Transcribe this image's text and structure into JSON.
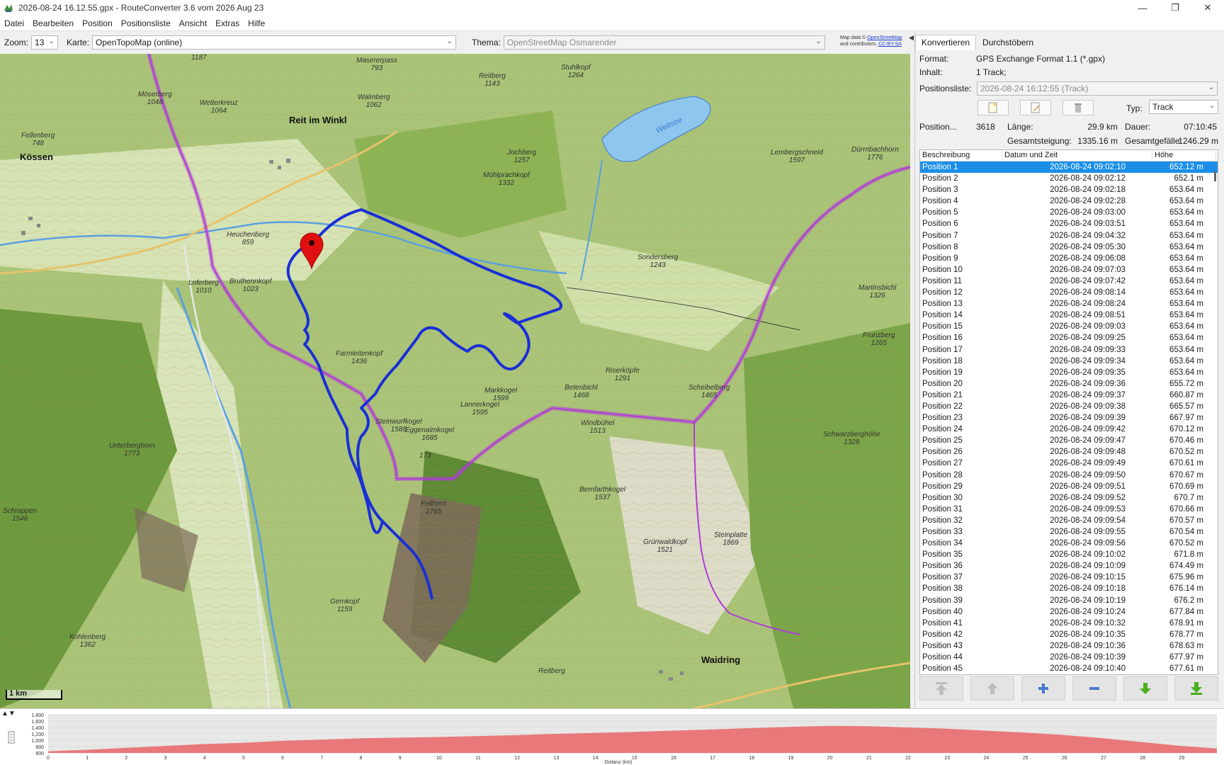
{
  "window": {
    "title": "2026-08-24 16.12.55.gpx - RouteConverter 3.6 vom 2026 Aug 23",
    "minimize": "—",
    "maximize": "❐",
    "close": "✕"
  },
  "menu": [
    "Datei",
    "Bearbeiten",
    "Position",
    "Positionsliste",
    "Ansicht",
    "Extras",
    "Hilfe"
  ],
  "map_toolbar": {
    "zoom_label": "Zoom:",
    "zoom_value": "13",
    "map_label": "Karte:",
    "map_value": "OpenTopoMap (online)",
    "theme_label": "Thema:",
    "theme_value": "OpenStreetMap Osmarender",
    "attribution_prefix": "Map data ©",
    "attribution_link1": "OpenStreetMap",
    "attribution_mid": "and contributors,",
    "attribution_link2": "CC-BY-SA"
  },
  "map": {
    "scale_label": "1 km",
    "labels": {
      "maserer": "Masererpass",
      "maserer_h": "793",
      "reitberg_top": "Reitberg",
      "reitberg_top_h": "1143",
      "stuhlkopf": "Stuhlkopf",
      "stuhlkopf_h": "1264",
      "weitsee": "Weitsee",
      "moserberg": "Möserberg",
      "moserberg_h": "1048",
      "wetterkreuz": "Wetterkreuz",
      "wetterkreuz_h": "1064",
      "walmberg": "Walmberg",
      "walmberg_h": "1062",
      "reit": "Reit im Winkl",
      "fellenberg": "Fellenberg",
      "fellenberg_h": "748",
      "kossen": "Kössen",
      "jochberg": "Jochberg",
      "jochberg_h": "1257",
      "muhlprachkopf": "Mühlprachkopf",
      "muhlprachkopf_h": "1332",
      "lembergschneid": "Lembergschneid",
      "lembergschneid_h": "1597",
      "durnbachhorn": "Dürrnbachhorn",
      "durnbachhorn_h": "1776",
      "heuchenberg": "Heuchenberg",
      "heuchenberg_h": "859",
      "sondersberg": "Sondersberg",
      "sondersberg_h": "1243",
      "loferberg": "Loferberg",
      "loferberg_h": "1010",
      "bruthenkopf": "Bruthennkopf",
      "bruthenkopf_h": "1023",
      "martinsbichl": "Martinsbichl",
      "martinsbichl_h": "1326",
      "frunzberg": "Frunzberg",
      "frunzberg_h": "1265",
      "farmleiten": "Farmleitenkopf",
      "farmleiten_h": "1436",
      "riserkopfe": "Riserköpfe",
      "riserkopfe_h": "1291",
      "markkogel": "Markkogel",
      "markkogel_h": "1599",
      "betenbichl": "Betenbichl",
      "betenbichl_h": "1468",
      "scheibelberg": "Scheibelberg",
      "scheibelberg_h": "1465",
      "lannerkogel": "Lannerkogel",
      "lannerkogel_h": "1595",
      "steinwurf": "Steinwurfkogel",
      "steinwurf_h": "1588",
      "eggenalm": "Eggenalmkogel",
      "eggenalm_h": "1685",
      "windbuhel": "Windbühel",
      "windbuhel_h": "1513",
      "schwarzberg": "Schwarzberghöhe",
      "schwarzberg_h": "1328",
      "unterberghorn": "Unterberghorn",
      "unterberghorn_h": "1773",
      "fellhorn": "Fellhorn",
      "fellhorn_h": "1765",
      "bernfarth": "Bernfarthkogel",
      "bernfarth_h": "1537",
      "schrappen": "Schrappen",
      "schrappen_h": "1546",
      "steinplatte": "Steinplatte",
      "steinplatte_h": "1869",
      "grunwald": "Grünwaldkopf",
      "grunwald_h": "1521",
      "gernkopf": "Gernkopf",
      "gernkopf_h": "1159",
      "kohlenberg": "Kohlenberg",
      "kohlenberg_h": "1362",
      "reitberg_bottom": "Reitberg",
      "waidring": "Waidring",
      "m1187": "1187",
      "m173": "173"
    }
  },
  "side": {
    "tabs": [
      "Konvertieren",
      "Durchstöbern"
    ],
    "format_label": "Format:",
    "format_value": "GPS Exchange Format 1.1 (*.gpx)",
    "content_label": "Inhalt:",
    "content_value": "1 Track;",
    "poslist_label": "Positionsliste:",
    "poslist_value": "2026-08-24 16:12:55 (Track)",
    "type_label": "Typ:",
    "type_value": "Track",
    "position_label": "Position...",
    "position_value": "3618",
    "length_label": "Länge:",
    "length_value": "29.9 km",
    "duration_label": "Dauer:",
    "duration_value": "07:10:45",
    "ascent_label": "Gesamtsteigung:",
    "ascent_value": "1335.16 m",
    "descent_label": "Gesamtgefälle:",
    "descent_value": "1246.29 m",
    "columns": [
      "Beschreibung",
      "Datum und Zeit",
      "Höhe"
    ],
    "rows": [
      [
        "Position 1",
        "2026-08-24 09:02:10",
        "652.12 m"
      ],
      [
        "Position 2",
        "2026-08-24 09:02:12",
        "652.1 m"
      ],
      [
        "Position 3",
        "2026-08-24 09:02:18",
        "653.64 m"
      ],
      [
        "Position 4",
        "2026-08-24 09:02:28",
        "653.64 m"
      ],
      [
        "Position 5",
        "2026-08-24 09:03:00",
        "653.64 m"
      ],
      [
        "Position 6",
        "2026-08-24 09:03:51",
        "653.64 m"
      ],
      [
        "Position 7",
        "2026-08-24 09:04:32",
        "653.64 m"
      ],
      [
        "Position 8",
        "2026-08-24 09:05:30",
        "653.64 m"
      ],
      [
        "Position 9",
        "2026-08-24 09:06:08",
        "653.64 m"
      ],
      [
        "Position 10",
        "2026-08-24 09:07:03",
        "653.64 m"
      ],
      [
        "Position 11",
        "2026-08-24 09:07:42",
        "653.64 m"
      ],
      [
        "Position 12",
        "2026-08-24 09:08:14",
        "653.64 m"
      ],
      [
        "Position 13",
        "2026-08-24 09:08:24",
        "653.64 m"
      ],
      [
        "Position 14",
        "2026-08-24 09:08:51",
        "653.64 m"
      ],
      [
        "Position 15",
        "2026-08-24 09:09:03",
        "653.64 m"
      ],
      [
        "Position 16",
        "2026-08-24 09:09:25",
        "653.64 m"
      ],
      [
        "Position 17",
        "2026-08-24 09:09:33",
        "653.64 m"
      ],
      [
        "Position 18",
        "2026-08-24 09:09:34",
        "653.64 m"
      ],
      [
        "Position 19",
        "2026-08-24 09:09:35",
        "653.64 m"
      ],
      [
        "Position 20",
        "2026-08-24 09:09:36",
        "655.72 m"
      ],
      [
        "Position 21",
        "2026-08-24 09:09:37",
        "660.87 m"
      ],
      [
        "Position 22",
        "2026-08-24 09:09:38",
        "665.57 m"
      ],
      [
        "Position 23",
        "2026-08-24 09:09:39",
        "667.97 m"
      ],
      [
        "Position 24",
        "2026-08-24 09:09:42",
        "670.12 m"
      ],
      [
        "Position 25",
        "2026-08-24 09:09:47",
        "670.46 m"
      ],
      [
        "Position 26",
        "2026-08-24 09:09:48",
        "670.52 m"
      ],
      [
        "Position 27",
        "2026-08-24 09:09:49",
        "670.61 m"
      ],
      [
        "Position 28",
        "2026-08-24 09:09:50",
        "670.67 m"
      ],
      [
        "Position 29",
        "2026-08-24 09:09:51",
        "670.69 m"
      ],
      [
        "Position 30",
        "2026-08-24 09:09:52",
        "670.7 m"
      ],
      [
        "Position 31",
        "2026-08-24 09:09:53",
        "670.66 m"
      ],
      [
        "Position 32",
        "2026-08-24 09:09:54",
        "670.57 m"
      ],
      [
        "Position 33",
        "2026-08-24 09:09:55",
        "670.54 m"
      ],
      [
        "Position 34",
        "2026-08-24 09:09:56",
        "670.52 m"
      ],
      [
        "Position 35",
        "2026-08-24 09:10:02",
        "671.8 m"
      ],
      [
        "Position 36",
        "2026-08-24 09:10:09",
        "674.49 m"
      ],
      [
        "Position 37",
        "2026-08-24 09:10:15",
        "675.96 m"
      ],
      [
        "Position 38",
        "2026-08-24 09:10:18",
        "676.14 m"
      ],
      [
        "Position 39",
        "2026-08-24 09:10:19",
        "676.2 m"
      ],
      [
        "Position 40",
        "2026-08-24 09:10:24",
        "677.84 m"
      ],
      [
        "Position 41",
        "2026-08-24 09:10:32",
        "678.91 m"
      ],
      [
        "Position 42",
        "2026-08-24 09:10:35",
        "678.77 m"
      ],
      [
        "Position 43",
        "2026-08-24 09:10:36",
        "678.63 m"
      ],
      [
        "Position 44",
        "2026-08-24 09:10:39",
        "677.97 m"
      ],
      [
        "Position 45",
        "2026-08-24 09:10:40",
        "677.61 m"
      ]
    ]
  },
  "elevation": {
    "y_ticks": [
      "1,800",
      "1,600",
      "1,400",
      "1,200",
      "1,000",
      "800",
      "600"
    ],
    "x_ticks": [
      "0",
      "1",
      "2",
      "3",
      "4",
      "5",
      "6",
      "7",
      "8",
      "9",
      "10",
      "11",
      "12",
      "13",
      "14",
      "15",
      "16",
      "17",
      "18",
      "19",
      "20",
      "21",
      "22",
      "23",
      "24",
      "25",
      "26",
      "27",
      "28",
      "29"
    ],
    "x_label": "Distanz (km)",
    "fill_color": "#e8787a",
    "profile_km": [
      0,
      1,
      2,
      3,
      4,
      5,
      6,
      7,
      8,
      9,
      10,
      11,
      12,
      13,
      14,
      15,
      16,
      17,
      18,
      19,
      20,
      21,
      22,
      23,
      24,
      25,
      26,
      27,
      28,
      29,
      29.9
    ],
    "profile_m": [
      652,
      700,
      760,
      820,
      880,
      920,
      980,
      1020,
      1060,
      1080,
      1100,
      1130,
      1160,
      1200,
      1230,
      1260,
      1300,
      1340,
      1380,
      1420,
      1450,
      1440,
      1400,
      1360,
      1300,
      1240,
      1160,
      1060,
      940,
      820,
      740
    ],
    "y_min": 600,
    "y_max": 1800,
    "x_max": 29.9
  },
  "colors": {
    "track": "#1a2fd6",
    "border": "#b23ad8",
    "selection": "#1b8fe8",
    "marker": "#e01010"
  }
}
